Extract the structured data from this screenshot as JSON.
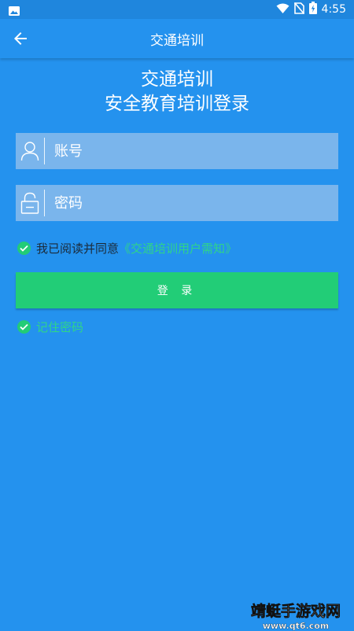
{
  "status_bar": {
    "time": "4:55"
  },
  "app_bar": {
    "title": "交通培训"
  },
  "headline": {
    "line1": "交通培训",
    "line2": "安全教育培训登录"
  },
  "form": {
    "account_placeholder": "账号",
    "password_placeholder": "密码",
    "agreement_prefix": "我已阅读并同意",
    "agreement_link": "《交通培训用户需知》",
    "login_label": "登 录",
    "remember_label": "记住密码",
    "agreement_checked": true,
    "remember_checked": true
  },
  "watermark": {
    "name": "靖蜓手游戏网",
    "url": "www.qt6.com"
  },
  "colors": {
    "background": "#2492ee",
    "field": "#7ab5ec",
    "accent_green": "#22cd77",
    "link_green": "#2fd489"
  }
}
